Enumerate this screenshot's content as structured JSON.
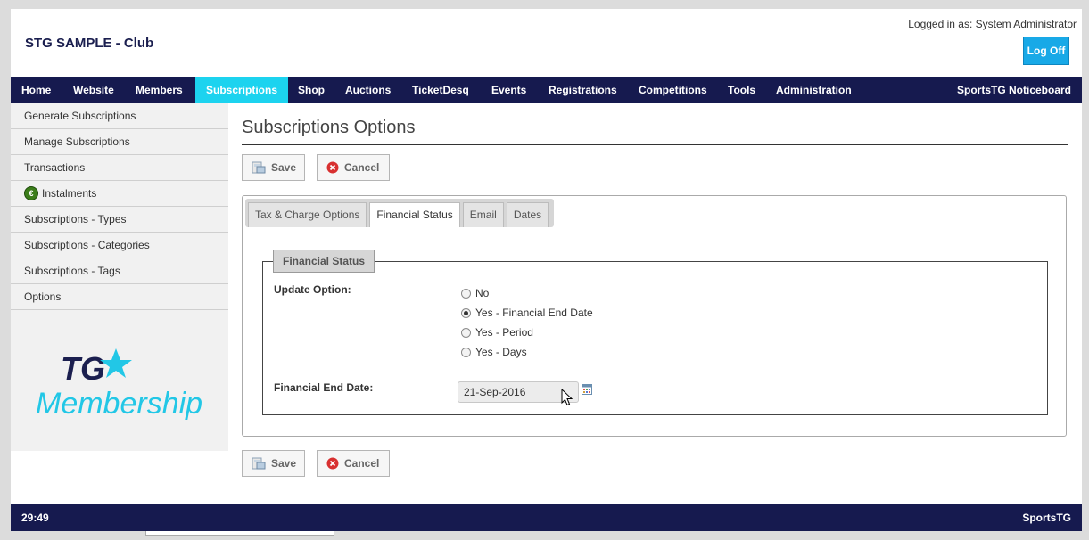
{
  "header": {
    "club_title": "STG SAMPLE - Club",
    "logged_in": "Logged in as: System Administrator",
    "logoff_label": "Log Off"
  },
  "nav": {
    "items": [
      "Home",
      "Website",
      "Members",
      "Subscriptions",
      "Shop",
      "Auctions",
      "TicketDesq",
      "Events",
      "Registrations",
      "Competitions",
      "Tools",
      "Administration"
    ],
    "active": "Subscriptions",
    "right_label": "SportsTG Noticeboard"
  },
  "sidebar": {
    "items": [
      "Generate Subscriptions",
      "Manage Subscriptions",
      "Transactions",
      "Instalments",
      "Subscriptions - Types",
      "Subscriptions - Categories",
      "Subscriptions - Tags",
      "Options"
    ],
    "logo_line1": "TG",
    "logo_line2": "Membership"
  },
  "main": {
    "title": "Subscriptions Options",
    "save_label": "Save",
    "cancel_label": "Cancel",
    "tabs": [
      "Tax & Charge Options",
      "Financial Status",
      "Email",
      "Dates"
    ],
    "active_tab": "Financial Status",
    "fieldset_legend": "Financial Status",
    "update_option_label": "Update Option:",
    "update_options": [
      "No",
      "Yes - Financial End Date",
      "Yes - Period",
      "Yes - Days"
    ],
    "selected_option": "Yes - Financial End Date",
    "end_date_label": "Financial End Date:",
    "end_date_value": "21-Sep-2016"
  },
  "footer": {
    "timer": "29:49",
    "brand": "SportsTG"
  },
  "colors": {
    "nav_bg": "#161a4f",
    "active_nav": "#1cd3ef",
    "logoff_bg": "#18a9e7",
    "logo": "#22c7e6"
  }
}
